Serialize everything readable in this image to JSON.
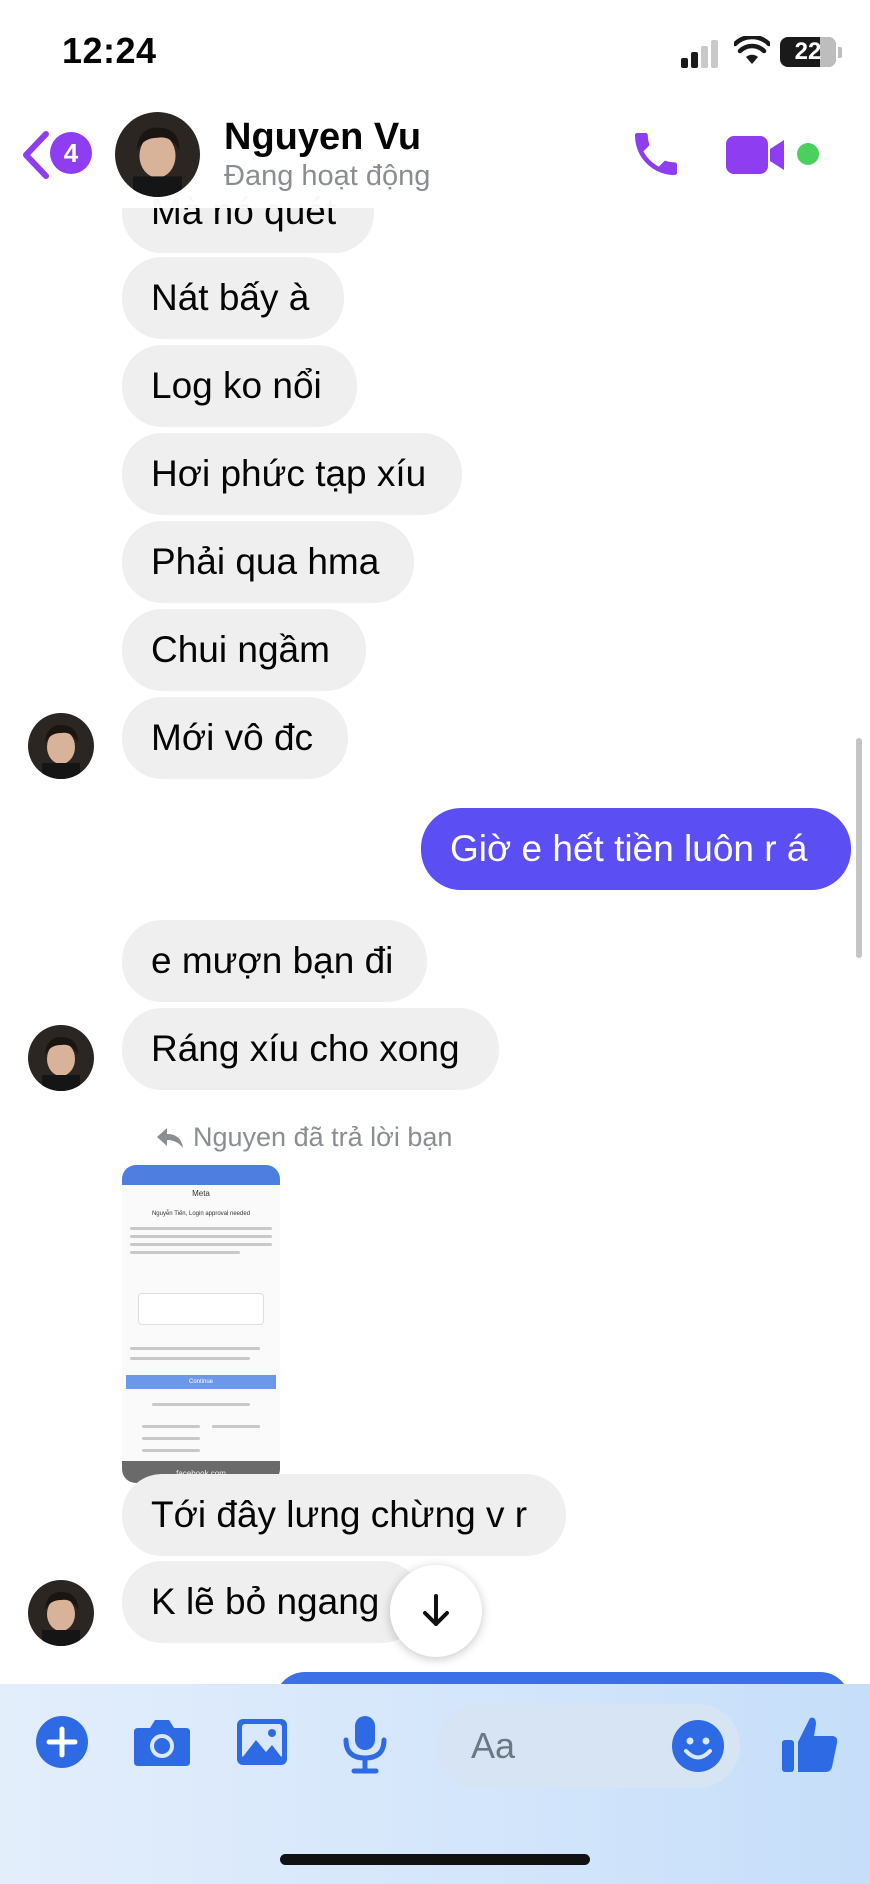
{
  "status_bar": {
    "time": "12:24",
    "battery": "22"
  },
  "header": {
    "back_badge": "4",
    "contact_name": "Nguyen Vu",
    "contact_status": "Đang hoạt động"
  },
  "messages": [
    {
      "dir": "in",
      "text": "Mà nó quét"
    },
    {
      "dir": "in",
      "text": "Nát bấy à"
    },
    {
      "dir": "in",
      "text": "Log ko nổi"
    },
    {
      "dir": "in",
      "text": "Hơi phức tạp xíu"
    },
    {
      "dir": "in",
      "text": "Phải qua hma"
    },
    {
      "dir": "in",
      "text": "Chui ngầm"
    },
    {
      "dir": "in",
      "text": "Mới vô đc"
    },
    {
      "dir": "out",
      "text": "Giờ e hết tiền luôn r á"
    },
    {
      "dir": "in",
      "text": "e mượn bạn đi"
    },
    {
      "dir": "in",
      "text": "Ráng xíu cho xong"
    },
    {
      "dir": "in",
      "text": "Tới đây lưng chừng v r"
    },
    {
      "dir": "in",
      "text": "K lẽ bỏ ngang"
    }
  ],
  "reply_note": "Nguyen đã trả lời bạn",
  "attachment": {
    "brand": "Meta",
    "title": "Nguyễn Tiến, Login approval needed",
    "button": "Continue",
    "url": "facebook.com"
  },
  "composer": {
    "placeholder": "Aa"
  },
  "colors": {
    "accent": "#8e3df0",
    "outgoing_bubble": "#5b4ff4",
    "composer_icons": "#2d6ae3",
    "online": "#4bd05f"
  },
  "icons": [
    "back-chevron-icon",
    "phone-icon",
    "video-camera-icon",
    "plus-icon",
    "camera-icon",
    "image-icon",
    "microphone-icon",
    "emoji-icon",
    "thumbs-up-icon",
    "arrow-down-icon",
    "reply-icon"
  ]
}
